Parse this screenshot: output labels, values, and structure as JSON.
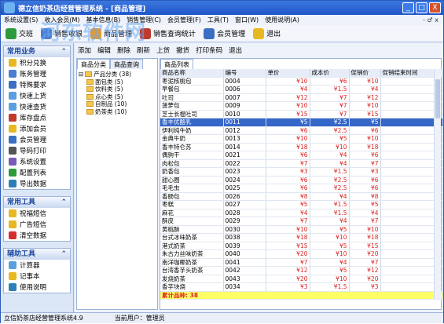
{
  "window": {
    "title": "德立信奶茶店经营管理系统 - [商品管理]",
    "min": "_",
    "max": "□",
    "close": "X"
  },
  "menu": [
    "系统设置(S)",
    "收入会员(M)",
    "基本信息(B)",
    "销售管理(C)",
    "会员管理(F)",
    "工具(T)",
    "窗口(W)",
    "使用说明(A)"
  ],
  "menu_right": "- ♂ x",
  "toolbar": [
    {
      "label": "交班",
      "icon": "handover-icon",
      "color": "#2d9b3b"
    },
    {
      "label": "销售收银",
      "icon": "cashier-icon",
      "color": "#4a7fd4"
    },
    {
      "label": "商品管理",
      "icon": "goods-icon",
      "color": "#e69a2a"
    },
    {
      "label": "销售查询统计",
      "icon": "chart-icon",
      "color": "#c0392b"
    },
    {
      "label": "会员管理",
      "icon": "member-icon",
      "color": "#3b6fc2"
    },
    {
      "label": "退出",
      "icon": "exit-icon",
      "color": "#e8b823"
    }
  ],
  "watermark": "河东软件网",
  "sidebar": {
    "sections": [
      {
        "title": "常用业务",
        "items": [
          "积分兑换",
          "账务管理",
          "特殊要求",
          "快速上货",
          "快速查货",
          "库存盘点",
          "添加会员",
          "会员管理",
          "导码打印",
          "系统设置",
          "配置列表",
          "导出数据"
        ]
      },
      {
        "title": "常用工具",
        "items": [
          "祝福短信",
          "广告短信",
          "清空数据"
        ]
      },
      {
        "title": "辅助工具",
        "items": [
          "计算器",
          "记事本",
          "使用说明"
        ]
      }
    ]
  },
  "subtool": [
    "添加",
    "编辑",
    "删除",
    "刷新",
    "上货",
    "撤货",
    "打印条码",
    "退出"
  ],
  "tree": {
    "tabs": [
      "商品分类",
      "商品查询"
    ],
    "root": "产品分类 (38)",
    "nodes": [
      "面包类 (5)",
      "饮料类 (5)",
      "点心类 (5)",
      "自制品 (10)",
      "奶茶类 (10)"
    ]
  },
  "grid": {
    "tab": "商品列表",
    "columns": [
      "商品名称",
      "编号",
      "单价",
      "成本价",
      "促销价",
      "促销结束时间"
    ],
    "rows": [
      [
        "枣泥核桃包",
        "0004",
        "¥10",
        "¥6",
        "¥10",
        ""
      ],
      [
        "早餐包",
        "0006",
        "¥4",
        "¥1.5",
        "¥4",
        ""
      ],
      [
        "吐司",
        "0007",
        "¥12",
        "¥7",
        "¥12",
        ""
      ],
      [
        "菠萝包",
        "0009",
        "¥10",
        "¥7",
        "¥10",
        ""
      ],
      [
        "芝士长棍吐司",
        "0010",
        "¥15",
        "¥7",
        "¥15",
        ""
      ],
      [
        "香丰优酪乳",
        "0011",
        "¥5",
        "¥2.5",
        "¥5",
        ""
      ],
      [
        "伊利纯牛奶",
        "0012",
        "¥6",
        "¥2.5",
        "¥6",
        ""
      ],
      [
        "金典牛奶",
        "0013",
        "¥10",
        "¥5",
        "¥10",
        ""
      ],
      [
        "香丰特仑苏",
        "0014",
        "¥18",
        "¥10",
        "¥18",
        ""
      ],
      [
        "偶驹干",
        "0021",
        "¥6",
        "¥4",
        "¥6",
        ""
      ],
      [
        "肉松包",
        "0022",
        "¥7",
        "¥4",
        "¥7",
        ""
      ],
      [
        "奶香包",
        "0023",
        "¥3",
        "¥1.5",
        "¥3",
        ""
      ],
      [
        "甜心圈",
        "0024",
        "¥6",
        "¥2.5",
        "¥6",
        ""
      ],
      [
        "毛毛虫",
        "0025",
        "¥6",
        "¥2.5",
        "¥6",
        ""
      ],
      [
        "香肠包",
        "0026",
        "¥8",
        "¥4",
        "¥8",
        ""
      ],
      [
        "枣糕",
        "0027",
        "¥5",
        "¥1.5",
        "¥5",
        ""
      ],
      [
        "麻花",
        "0028",
        "¥4",
        "¥1.5",
        "¥4",
        ""
      ],
      [
        "酥皮",
        "0029",
        "¥7",
        "¥4",
        "¥7",
        ""
      ],
      [
        "黄桃酥",
        "0030",
        "¥10",
        "¥5",
        "¥10",
        ""
      ],
      [
        "台式冰味奶茶",
        "0038",
        "¥18",
        "¥10",
        "¥18",
        ""
      ],
      [
        "港式奶茶",
        "0039",
        "¥15",
        "¥5",
        "¥15",
        ""
      ],
      [
        "朱古力丝味奶茶",
        "0040",
        "¥20",
        "¥10",
        "¥20",
        ""
      ],
      [
        "南洋咖椰奶茶",
        "0041",
        "¥7",
        "¥4",
        "¥7",
        ""
      ],
      [
        "台湾香芋头奶茶",
        "0042",
        "¥12",
        "¥5",
        "¥12",
        ""
      ],
      [
        "发烧奶茶",
        "0043",
        "¥20",
        "¥10",
        "¥20",
        ""
      ],
      [
        "香芋块烧",
        "0034",
        "¥3",
        "¥1.5",
        "¥3",
        ""
      ]
    ],
    "selected_index": 5,
    "total_label": "累计品种: 38"
  },
  "status": {
    "left": "立信奶茶店经营管理系统4.9",
    "right": "当前用户：管理员"
  }
}
